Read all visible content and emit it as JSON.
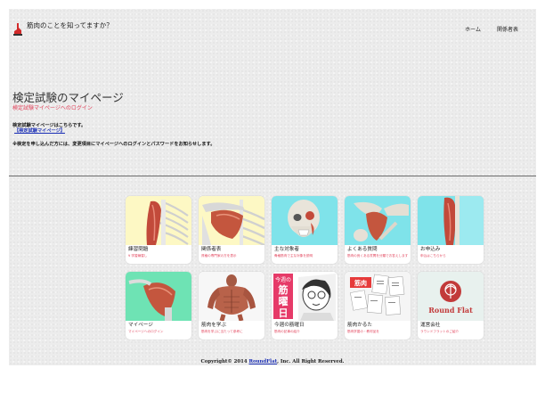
{
  "header": {
    "site_title": "筋肉のことを知ってますか？",
    "nav": [
      {
        "label": "ホーム"
      },
      {
        "label": "関係者表"
      }
    ]
  },
  "main": {
    "title": "検定試験のマイページ",
    "subtitle": "検定試験マイページへのログイン",
    "para1": "検定試験マイページはこちらです。",
    "mypage_link": "【検定試験マイページ】",
    "para2": "※検定を申し込んだ方には、変更項目にマイページへのログインとパスワードをお知らせします。"
  },
  "tiles": [
    {
      "label": "練習問題",
      "sub": "¥ 学習練習し",
      "icon": "arm-muscle-icon"
    },
    {
      "label": "関係者表",
      "sub": "資格の専門家の方を表示",
      "icon": "shoulder-muscle-icon"
    },
    {
      "label": "主な対象者",
      "sub": "骨格筋肉で主な対象を説明",
      "icon": "skull-face-muscle-icon"
    },
    {
      "label": "よくある質問",
      "sub": "筋肉の良くある質問を分類でお答えします",
      "icon": "hip-muscle-icon"
    },
    {
      "label": "お申込み",
      "sub": "申込はこちらから",
      "icon": "leg-muscle-icon"
    },
    {
      "label": "マイページ",
      "sub": "マイページへのログイン",
      "icon": "deltoid-muscle-icon"
    },
    {
      "label": "筋肉を学ぶ",
      "sub": "筋肉を学ぶに当たって参考に",
      "icon": "full-body-muscle-icon"
    },
    {
      "label": "今週の筋曜日",
      "sub": "筋肉の記事の紹介",
      "icon": "manga-kinyoubi-icon"
    },
    {
      "label": "筋肉かるた",
      "sub": "筋肉学習の・教材品を",
      "icon": "karuta-cards-icon"
    },
    {
      "label": "運営会社",
      "sub": "ラウンドフラットのご紹介",
      "icon": "roundflat-logo-icon"
    }
  ],
  "manga": {
    "line1": "今週の",
    "line2": "筋",
    "line3": "曜",
    "line4": "日"
  },
  "karuta_text": "筋肉",
  "logo": {
    "name": "Round Flat"
  },
  "footer": {
    "copyright_prefix": "Copyright© 2014 ",
    "company": "RoundFlat",
    "copyright_suffix": ", Inc. All Right Reserved."
  },
  "colors": {
    "accent": "#e2445c",
    "link": "#1b2fb5",
    "bg": "#ececec"
  }
}
